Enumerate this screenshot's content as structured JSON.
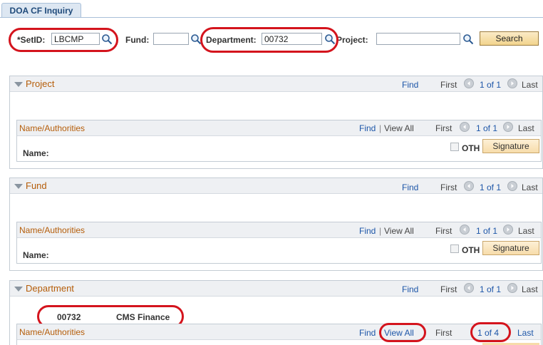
{
  "tab": {
    "label": "DOA CF Inquiry"
  },
  "search": {
    "setid_label": "*SetID:",
    "setid_value": "LBCMP",
    "fund_label": "Fund:",
    "fund_value": "",
    "department_label": "Department:",
    "department_value": "00732",
    "project_label": "Project:",
    "project_value": "",
    "search_button": "Search"
  },
  "nav": {
    "find": "Find",
    "view_all": "View All",
    "sep": "|",
    "first": "First",
    "last": "Last"
  },
  "project": {
    "title": "Project",
    "count": "1 of 1",
    "sub": {
      "title": "Name/Authorities",
      "count": "1 of 1",
      "name_label": "Name:",
      "oth_label": "OTH",
      "signature_button": "Signature"
    }
  },
  "fund": {
    "title": "Fund",
    "count": "1 of 1",
    "sub": {
      "title": "Name/Authorities",
      "count": "1 of 1",
      "name_label": "Name:",
      "oth_label": "OTH",
      "signature_button": "Signature"
    }
  },
  "department": {
    "title": "Department",
    "count": "1 of 1",
    "code": "00732",
    "name": "CMS Finance",
    "sub": {
      "title": "Name/Authorities",
      "count": "1 of 4"
    }
  },
  "colors": {
    "accent": "#b55d09",
    "link": "#1d56a8",
    "highlight": "#d4141d"
  }
}
